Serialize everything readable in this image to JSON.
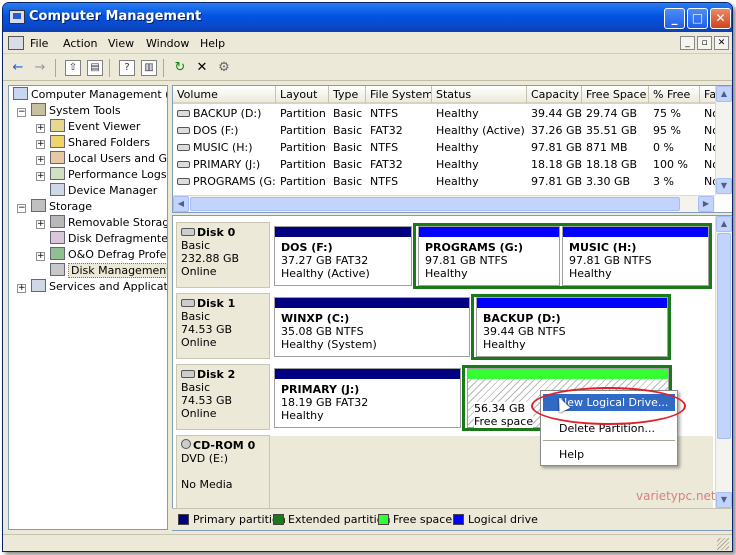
{
  "window": {
    "title": "Computer Management",
    "minimize": "_",
    "maximize": "□",
    "close": "✕"
  },
  "menu": {
    "items": [
      "File",
      "Action",
      "View",
      "Window",
      "Help"
    ],
    "mdi": [
      "_",
      "▫",
      "✕"
    ]
  },
  "toolbar": {
    "back": "←",
    "forward": "→",
    "up": "⇧",
    "show_hide": "▤",
    "help": "?",
    "properties": "▥",
    "refresh": "↻",
    "delete": "✕",
    "settings": "⚙"
  },
  "tree": {
    "root": "Computer Management (Loc",
    "system_tools": "System Tools",
    "event_viewer": "Event Viewer",
    "shared_folders": "Shared Folders",
    "local_users": "Local Users and Gro",
    "performance": "Performance Logs a",
    "device_manager": "Device Manager",
    "storage": "Storage",
    "removable": "Removable Storage",
    "defragmenter": "Disk Defragmenter",
    "oo_defrag": "O&O Defrag Profes",
    "disk_management": "Disk Management",
    "services": "Services and Application",
    "exp_minus": "−",
    "exp_plus": "+"
  },
  "volumes": {
    "headers": [
      "Volume",
      "Layout",
      "Type",
      "File System",
      "Status",
      "Capacity",
      "Free Space",
      "% Free",
      "Fa"
    ],
    "rows": [
      {
        "volume": "BACKUP (D:)",
        "layout": "Partition",
        "type": "Basic",
        "fs": "NTFS",
        "status": "Healthy",
        "capacity": "39.44 GB",
        "free": "29.74 GB",
        "pct": "75 %",
        "fa": "No"
      },
      {
        "volume": "DOS (F:)",
        "layout": "Partition",
        "type": "Basic",
        "fs": "FAT32",
        "status": "Healthy (Active)",
        "capacity": "37.26 GB",
        "free": "35.51 GB",
        "pct": "95 %",
        "fa": "No"
      },
      {
        "volume": "MUSIC (H:)",
        "layout": "Partition",
        "type": "Basic",
        "fs": "NTFS",
        "status": "Healthy",
        "capacity": "97.81 GB",
        "free": "871 MB",
        "pct": "0 %",
        "fa": "No"
      },
      {
        "volume": "PRIMARY (J:)",
        "layout": "Partition",
        "type": "Basic",
        "fs": "FAT32",
        "status": "Healthy",
        "capacity": "18.18 GB",
        "free": "18.18 GB",
        "pct": "100 %",
        "fa": "No"
      },
      {
        "volume": "PROGRAMS (G:)",
        "layout": "Partition",
        "type": "Basic",
        "fs": "NTFS",
        "status": "Healthy",
        "capacity": "97.81 GB",
        "free": "3.30 GB",
        "pct": "3 %",
        "fa": "No"
      }
    ]
  },
  "disks": {
    "disk0": {
      "name": "Disk 0",
      "type": "Basic",
      "size": "232.88 GB",
      "state": "Online"
    },
    "disk1": {
      "name": "Disk 1",
      "type": "Basic",
      "size": "74.53 GB",
      "state": "Online"
    },
    "disk2": {
      "name": "Disk 2",
      "type": "Basic",
      "size": "74.53 GB",
      "state": "Online"
    },
    "cdrom0": {
      "name": "CD-ROM 0",
      "type": "DVD (E:)",
      "state": "No Media"
    }
  },
  "partitions": {
    "dos": {
      "name": "DOS  (F:)",
      "info": "37.27 GB FAT32",
      "status": "Healthy (Active)"
    },
    "programs": {
      "name": "PROGRAMS  (G:)",
      "info": "97.81 GB NTFS",
      "status": "Healthy"
    },
    "music": {
      "name": "MUSIC  (H:)",
      "info": "97.81 GB NTFS",
      "status": "Healthy"
    },
    "winxp": {
      "name": "WINXP  (C:)",
      "info": "35.08 GB NTFS",
      "status": "Healthy (System)"
    },
    "backup": {
      "name": "BACKUP  (D:)",
      "info": "39.44 GB NTFS",
      "status": "Healthy"
    },
    "primary": {
      "name": "PRIMARY  (J:)",
      "info": "18.19 GB FAT32",
      "status": "Healthy"
    },
    "free": {
      "size": "56.34 GB",
      "label": "Free space"
    }
  },
  "colors": {
    "primary": "#000080",
    "extended": "#1a7a1a",
    "free": "#33ff33",
    "logical": "#0000ff"
  },
  "legend": {
    "primary": "Primary partition",
    "extended": "Extended partition",
    "free": "Free space",
    "logical": "Logical drive"
  },
  "context_menu": {
    "new_logical": "New Logical Drive...",
    "delete_partition": "Delete Partition...",
    "help": "Help"
  },
  "watermark": "varietypc.net"
}
